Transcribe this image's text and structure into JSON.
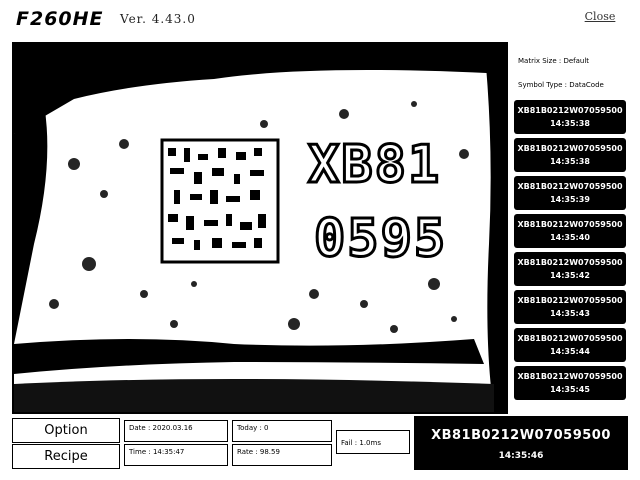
{
  "header": {
    "title": "F260HE",
    "version": "Ver. 4.43.0",
    "close_label": "Close"
  },
  "camera": {
    "overlay_text_line1": "XB81",
    "overlay_text_line2": "0595"
  },
  "sidebar": {
    "matrix_size": "Matrix Size : Default",
    "symbol_type": "Symbol Type : DataCode",
    "reads": [
      {
        "code": "XB81B0212W07059500",
        "time": "14:35:38"
      },
      {
        "code": "XB81B0212W07059500",
        "time": "14:35:38"
      },
      {
        "code": "XB81B0212W07059500",
        "time": "14:35:39"
      },
      {
        "code": "XB81B0212W07059500",
        "time": "14:35:40"
      },
      {
        "code": "XB81B0212W07059500",
        "time": "14:35:42"
      },
      {
        "code": "XB81B0212W07059500",
        "time": "14:35:43"
      },
      {
        "code": "XB81B0212W07059500",
        "time": "14:35:44"
      },
      {
        "code": "XB81B0212W07059500",
        "time": "14:35:45"
      }
    ]
  },
  "bottom": {
    "option_label": "Option",
    "recipe_label": "Recipe",
    "date": "Date : 2020.03.16",
    "time": "Time : 14:35:47",
    "today": "Today : 0",
    "rate": "Rate : 98.59",
    "fail": "Fail : 1.0ms",
    "last_code": "XB81B0212W07059500",
    "last_time": "14:35:46"
  }
}
